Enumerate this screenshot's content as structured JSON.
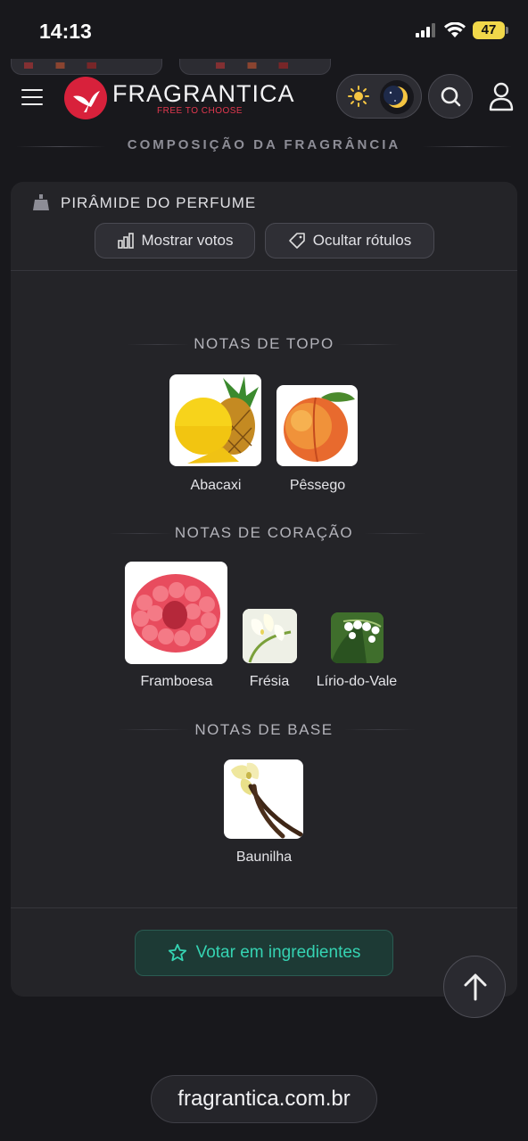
{
  "status_bar": {
    "time": "14:13",
    "battery": "47"
  },
  "header": {
    "logo_name": "FRAGRANTICA",
    "logo_tagline": "FREE TO CHOOSE"
  },
  "section": {
    "title": "COMPOSIÇÃO DA FRAGRÂNCIA"
  },
  "pyramid": {
    "title": "PIRÂMIDE DO PERFUME",
    "show_votes_label": "Mostrar votos",
    "hide_labels_label": "Ocultar rótulos",
    "top_notes": {
      "title": "NOTAS DE TOPO",
      "items": [
        {
          "label": "Abacaxi",
          "icon": "pineapple"
        },
        {
          "label": "Pêssego",
          "icon": "peach"
        }
      ]
    },
    "heart_notes": {
      "title": "NOTAS DE CORAÇÃO",
      "items": [
        {
          "label": "Framboesa",
          "icon": "raspberry"
        },
        {
          "label": "Frésia",
          "icon": "freesia"
        },
        {
          "label": "Lírio-do-Vale",
          "icon": "lily-of-the-valley"
        }
      ]
    },
    "base_notes": {
      "title": "NOTAS DE BASE",
      "items": [
        {
          "label": "Baunilha",
          "icon": "vanilla"
        }
      ]
    },
    "vote_button_label": "Votar em ingredientes"
  },
  "footer": {
    "url": "fragrantica.com.br"
  },
  "colors": {
    "accent_teal": "#35d3b2",
    "brand_red": "#d8213b",
    "background": "#18181c",
    "card": "#242428"
  }
}
